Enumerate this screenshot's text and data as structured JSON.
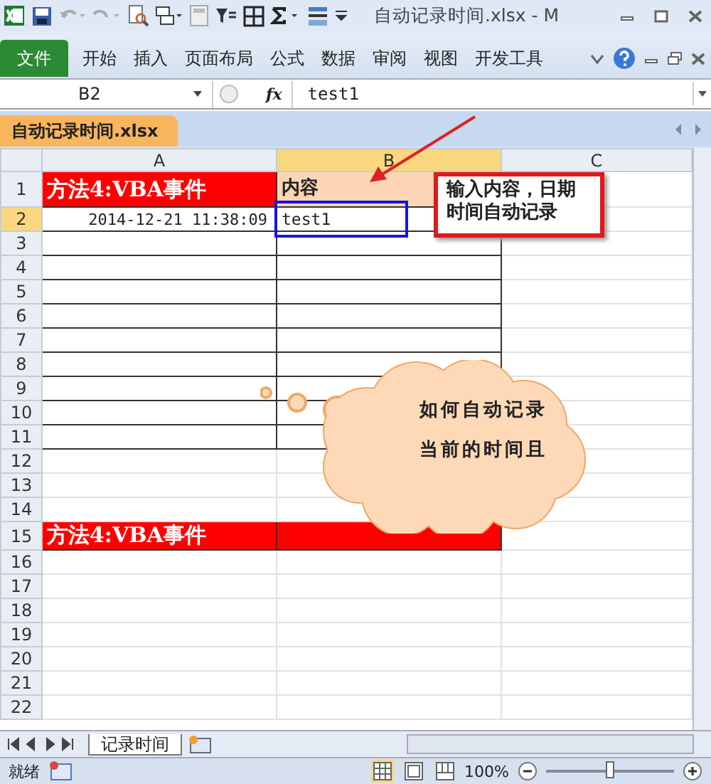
{
  "window": {
    "title": "自动记录时间.xlsx - M"
  },
  "ribbon_tabs": [
    {
      "label": "文件",
      "selected": true
    },
    {
      "label": "开始",
      "selected": false
    },
    {
      "label": "插入",
      "selected": false
    },
    {
      "label": "页面布局",
      "selected": false
    },
    {
      "label": "公式",
      "selected": false
    },
    {
      "label": "数据",
      "selected": false
    },
    {
      "label": "审阅",
      "selected": false
    },
    {
      "label": "视图",
      "selected": false
    },
    {
      "label": "开发工具",
      "selected": false
    }
  ],
  "formula_bar": {
    "name_box": "B2",
    "function_label": "fx",
    "value": "test1"
  },
  "workbook_tab": {
    "label": "自动记录时间.xlsx"
  },
  "columns": [
    {
      "label": "A",
      "selected": false
    },
    {
      "label": "B",
      "selected": true
    },
    {
      "label": "C",
      "selected": false
    }
  ],
  "rows": [
    {
      "label": "1",
      "selected": false,
      "cells": [
        {
          "kind": "title",
          "text": "方法4:VBA事件"
        },
        {
          "kind": "header",
          "text": "内容"
        }
      ]
    },
    {
      "label": "2",
      "selected": true,
      "cells": [
        {
          "kind": "date",
          "text": "2014-12-21 11:38:09"
        },
        {
          "kind": "text",
          "text": "test1"
        }
      ]
    },
    {
      "label": "3",
      "selected": false,
      "cells": [
        {
          "kind": "text"
        },
        {
          "kind": "text"
        }
      ]
    },
    {
      "label": "4",
      "selected": false,
      "cells": [
        {
          "kind": "text"
        },
        {
          "kind": "text"
        }
      ]
    },
    {
      "label": "5",
      "selected": false,
      "cells": [
        {
          "kind": "text"
        },
        {
          "kind": "text"
        }
      ]
    },
    {
      "label": "6",
      "selected": false,
      "cells": [
        {
          "kind": "text"
        },
        {
          "kind": "text"
        }
      ]
    },
    {
      "label": "7",
      "selected": false,
      "cells": [
        {
          "kind": "text"
        },
        {
          "kind": "text"
        }
      ]
    },
    {
      "label": "8",
      "selected": false,
      "cells": [
        {
          "kind": "text"
        },
        {
          "kind": "text"
        }
      ]
    },
    {
      "label": "9",
      "selected": false,
      "cells": [
        {
          "kind": "text"
        },
        {
          "kind": "text"
        }
      ]
    },
    {
      "label": "10",
      "selected": false,
      "cells": [
        {
          "kind": "text"
        },
        {
          "kind": "text"
        }
      ]
    },
    {
      "label": "11",
      "selected": false,
      "cells": [
        {
          "kind": "text"
        },
        {
          "kind": "text"
        }
      ]
    },
    {
      "label": "12",
      "selected": false,
      "cells": []
    },
    {
      "label": "13",
      "selected": false,
      "cells": []
    },
    {
      "label": "14",
      "selected": false,
      "cells": []
    },
    {
      "label": "15",
      "selected": false,
      "cells": [
        {
          "kind": "title",
          "text": "方法4:VBA事件"
        },
        {
          "kind": "title"
        }
      ]
    },
    {
      "label": "16",
      "selected": false,
      "cells": []
    },
    {
      "label": "17",
      "selected": false,
      "cells": []
    },
    {
      "label": "18",
      "selected": false,
      "cells": []
    },
    {
      "label": "19",
      "selected": false,
      "cells": []
    },
    {
      "label": "20",
      "selected": false,
      "cells": []
    },
    {
      "label": "21",
      "selected": false,
      "cells": []
    },
    {
      "label": "22",
      "selected": false,
      "cells": []
    }
  ],
  "annotations": {
    "note": "输入内容，日期时间自动记录",
    "cloud": [
      "如何自动记录",
      "当前的时间且"
    ]
  },
  "sheet_tabs": [
    {
      "label": "记录时间",
      "selected": true
    }
  ],
  "status_bar": {
    "status": "就绪",
    "zoom": "100%",
    "zoom_slider": {
      "level": 0.5
    }
  }
}
